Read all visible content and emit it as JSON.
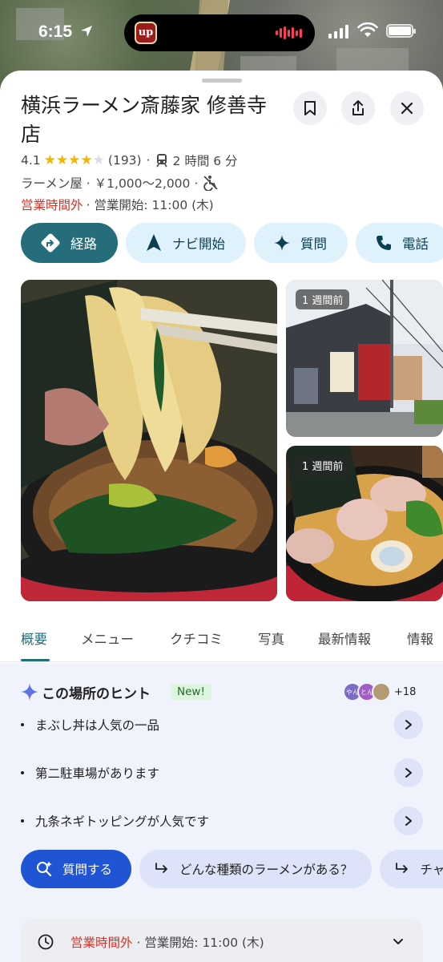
{
  "status_bar": {
    "time": "6:15",
    "island_app_text": "up"
  },
  "place": {
    "name": "横浜ラーメン斎藤家 修善寺店",
    "rating": "4.1",
    "rating_value": 4.1,
    "review_count": "(193)",
    "transit_time": "2 時間 6 分",
    "category_line": "ラーメン屋 · ￥1,000～2,000 ·",
    "status_closed": "営業時間外",
    "status_opens": "· 営業開始: 11:00 (木)"
  },
  "header_buttons": {
    "save": "bookmark-icon",
    "share": "share-icon",
    "close": "close-icon"
  },
  "actions": [
    {
      "label": "経路",
      "icon": "directions-icon"
    },
    {
      "label": "ナビ開始",
      "icon": "navigation-icon"
    },
    {
      "label": "質問",
      "icon": "sparkle-icon"
    },
    {
      "label": "電話",
      "icon": "phone-icon"
    }
  ],
  "photos": [
    {
      "badge": ""
    },
    {
      "badge": "1 週間前"
    },
    {
      "badge": "1 週間前"
    }
  ],
  "tabs": [
    "概要",
    "メニュー",
    "クチコミ",
    "写真",
    "最新情報",
    "情報"
  ],
  "hints": {
    "title": "この場所のヒント",
    "new_badge": "New!",
    "avatar_1": "やん",
    "avatar_2": "とん",
    "contributors_more": "+18",
    "items": [
      "まぶし丼は人気の一品",
      "第二駐車場があります",
      "九条ネギトッピングが人気です"
    ],
    "ask_button": "質問する",
    "suggestions": [
      "どんな種類のラーメンがある？",
      "チャ"
    ]
  },
  "hours_card": {
    "closed": "営業時間外",
    "opens": " · 営業開始: 11:00 (木)"
  },
  "colors": {
    "primary_teal": "#256d7b",
    "chip_bg": "#dff2fc",
    "star": "#f4b400",
    "closed_red": "#d93025",
    "ask_blue": "#1f54d4"
  }
}
